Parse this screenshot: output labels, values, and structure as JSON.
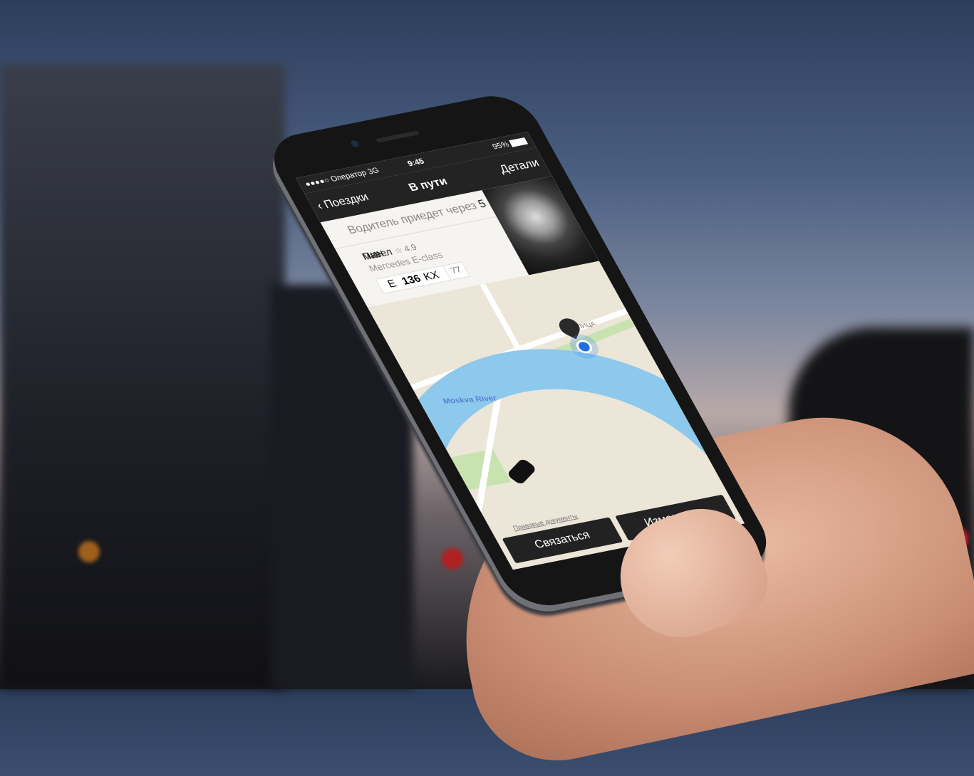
{
  "status_bar": {
    "signal": "●●●●○",
    "carrier": "Оператор",
    "network": "3G",
    "time": "9:45",
    "battery": "95%"
  },
  "nav": {
    "back_label": "Поездки",
    "title": "В пути",
    "right_label": "Детали"
  },
  "eta": {
    "prefix": "Водитель приедет через",
    "value": "5 мин"
  },
  "driver": {
    "name": "Павел",
    "rating": "☆ 4.9",
    "car": "Mercedes E-class",
    "plate": {
      "letter1": "E",
      "number": "136",
      "letters2": "KX",
      "region": "77"
    }
  },
  "map": {
    "river_label": "Moskva River",
    "street_label": "УЛИЦА",
    "legal_link": "Правовые документы",
    "colors": {
      "water": "#8cc9ec",
      "park": "#c8e2b0",
      "land": "#ece6d8",
      "location": "#1d6fe0"
    }
  },
  "actions": {
    "contact": "Связаться",
    "change": "Изменить..."
  }
}
